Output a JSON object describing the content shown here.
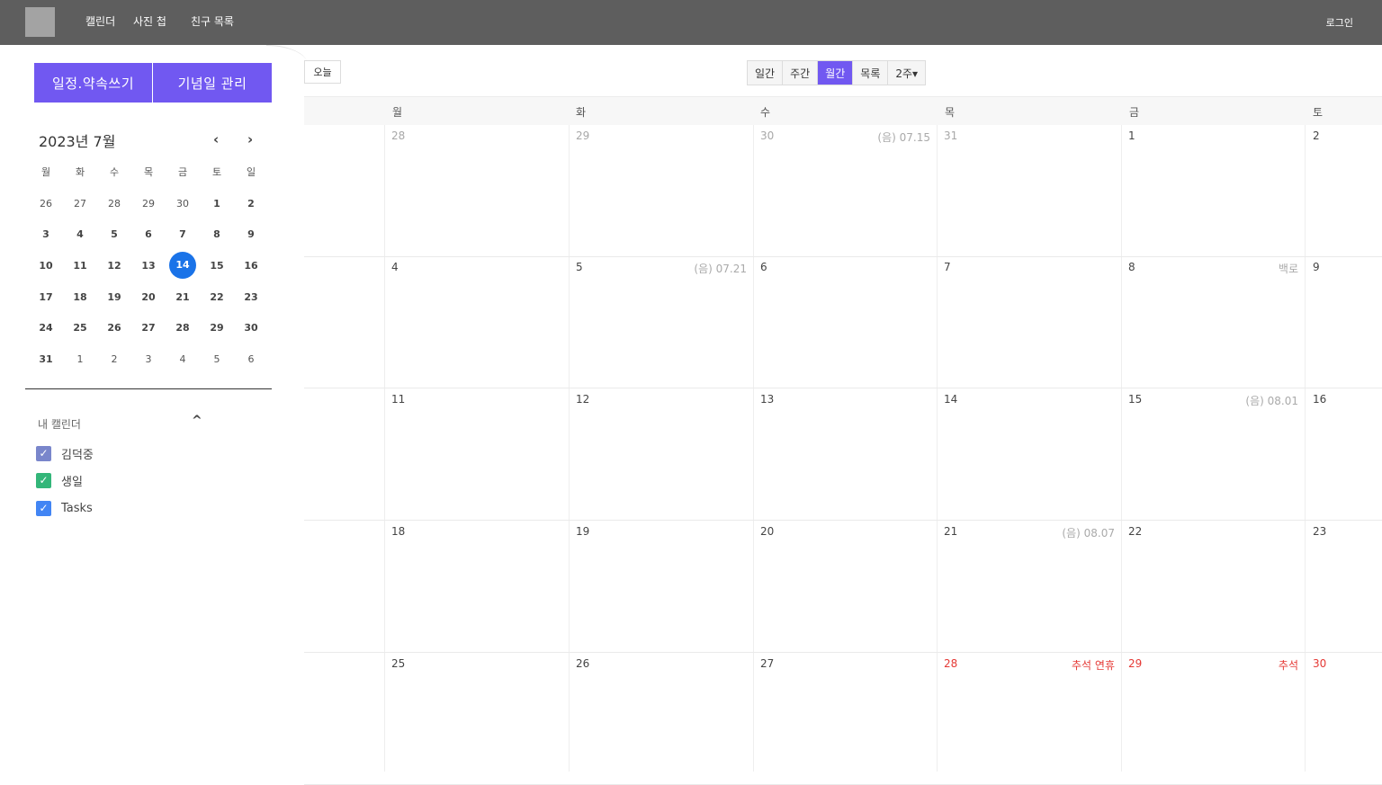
{
  "topbar": {
    "nav": [
      "캘린더",
      "사진 첩",
      "친구 목록"
    ],
    "login": "로그인"
  },
  "sidebar": {
    "add_button": "일정.약속쓰기",
    "anniversary_button": "기념일 관리",
    "mini_calendar": {
      "title": "2023년 7월",
      "prev": "‹",
      "next": "›",
      "weekdays": [
        "월",
        "화",
        "수",
        "목",
        "금",
        "토",
        "일"
      ],
      "weeks": [
        [
          "26",
          "27",
          "28",
          "29",
          "30",
          "1",
          "2"
        ],
        [
          "3",
          "4",
          "5",
          "6",
          "7",
          "8",
          "9"
        ],
        [
          "10",
          "11",
          "12",
          "13",
          "14",
          "15",
          "16"
        ],
        [
          "17",
          "18",
          "19",
          "20",
          "21",
          "22",
          "23"
        ],
        [
          "24",
          "25",
          "26",
          "27",
          "28",
          "29",
          "30"
        ],
        [
          "31",
          "1",
          "2",
          "3",
          "4",
          "5",
          "6"
        ]
      ],
      "today": "14"
    },
    "my_calendars": {
      "title": "내 캘린더",
      "toggle": "^",
      "items": [
        {
          "label": "김덕중",
          "color": "#7986cb"
        },
        {
          "label": "생일",
          "color": "#33b679"
        },
        {
          "label": "Tasks",
          "color": "#4285f4"
        }
      ]
    }
  },
  "main": {
    "today_button": "오늘",
    "views": [
      "일간",
      "주간",
      "월간",
      "목록",
      "2주▾"
    ],
    "active_view": "월간",
    "weekdays": [
      "월",
      "화",
      "수",
      "목",
      "금",
      "토"
    ],
    "weeks": [
      {
        "days": [
          {
            "num": "28",
            "other": true
          },
          {
            "num": "29",
            "other": true
          },
          {
            "num": "30",
            "other": true,
            "extra": "(음) 07.15"
          },
          {
            "num": "31",
            "other": true
          },
          {
            "num": "1"
          },
          {
            "num": "2"
          }
        ]
      },
      {
        "days": [
          {
            "num": "4"
          },
          {
            "num": "5",
            "extra": "(음) 07.21"
          },
          {
            "num": "6"
          },
          {
            "num": "7"
          },
          {
            "num": "8",
            "extra": "백로"
          },
          {
            "num": "9"
          }
        ]
      },
      {
        "days": [
          {
            "num": "11"
          },
          {
            "num": "12"
          },
          {
            "num": "13"
          },
          {
            "num": "14"
          },
          {
            "num": "15",
            "extra": "(음) 08.01"
          },
          {
            "num": "16"
          }
        ]
      },
      {
        "days": [
          {
            "num": "18"
          },
          {
            "num": "19"
          },
          {
            "num": "20"
          },
          {
            "num": "21",
            "extra": "(음) 08.07"
          },
          {
            "num": "22"
          },
          {
            "num": "23"
          }
        ]
      },
      {
        "days": [
          {
            "num": "25"
          },
          {
            "num": "26"
          },
          {
            "num": "27"
          },
          {
            "num": "28",
            "holiday": true,
            "extra": "추석 연휴"
          },
          {
            "num": "29",
            "holiday": true,
            "extra": "추석"
          },
          {
            "num": "30",
            "holiday": true
          }
        ]
      }
    ]
  }
}
